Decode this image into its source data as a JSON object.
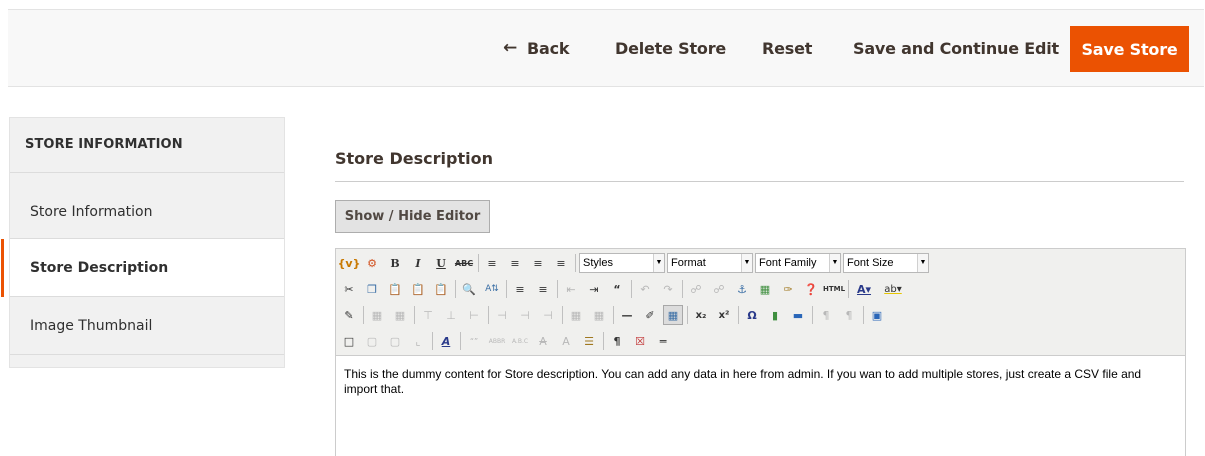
{
  "actions": {
    "back": "Back",
    "delete": "Delete Store",
    "reset": "Reset",
    "save_continue": "Save and Continue Edit",
    "save": "Save Store",
    "accent_color": "#eb5202"
  },
  "sidebar": {
    "title": "STORE INFORMATION",
    "items": [
      {
        "label": "Store Information",
        "active": false
      },
      {
        "label": "Store Description",
        "active": true
      },
      {
        "label": "Image Thumbnail",
        "active": false
      }
    ]
  },
  "main": {
    "section_title": "Store Description",
    "toggle_editor": "Show / Hide Editor"
  },
  "editor": {
    "selects": {
      "styles": "Styles",
      "format": "Format",
      "font_family": "Font Family",
      "font_size": "Font Size"
    },
    "content": "This is the dummy content for Store description. You can add any data in here from admin. If you wan to add multiple stores, just create a CSV file and import that."
  }
}
